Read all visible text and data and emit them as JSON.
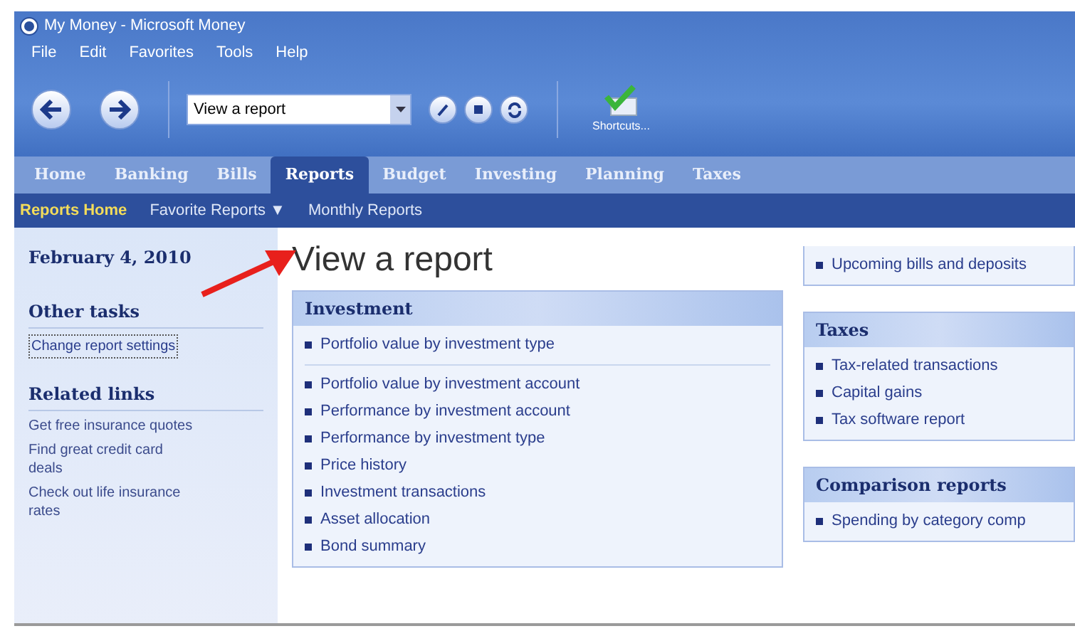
{
  "window": {
    "title": "My Money - Microsoft Money"
  },
  "menu": [
    "File",
    "Edit",
    "Favorites",
    "Tools",
    "Help"
  ],
  "toolbar": {
    "address": {
      "value": "View a report"
    },
    "shortcuts_label": "Shortcuts..."
  },
  "tabs": [
    {
      "label": "Home",
      "selected": false
    },
    {
      "label": "Banking",
      "selected": false
    },
    {
      "label": "Bills",
      "selected": false
    },
    {
      "label": "Reports",
      "selected": true
    },
    {
      "label": "Budget",
      "selected": false
    },
    {
      "label": "Investing",
      "selected": false
    },
    {
      "label": "Planning",
      "selected": false
    },
    {
      "label": "Taxes",
      "selected": false
    }
  ],
  "subnav": [
    {
      "label": "Reports Home",
      "selected": true
    },
    {
      "label": "Favorite Reports",
      "selected": false,
      "caret": "▼"
    },
    {
      "label": "Monthly Reports",
      "selected": false
    }
  ],
  "sidebar": {
    "date": "February 4, 2010",
    "other_tasks": {
      "heading": "Other tasks",
      "items": [
        "Change report settings"
      ]
    },
    "related_links": {
      "heading": "Related links",
      "items": [
        "Get free insurance quotes",
        "Find great credit card deals",
        "Check out life insurance rates"
      ]
    }
  },
  "page_title": "View a report",
  "left_column": [
    {
      "heading": "Investment",
      "groups": [
        [
          "Portfolio value by investment type"
        ],
        [
          "Portfolio value by investment account",
          "Performance by investment account",
          "Performance by investment type",
          "Price history",
          "Investment transactions",
          "Asset allocation",
          "Bond summary"
        ]
      ]
    }
  ],
  "right_column": [
    {
      "groups": [
        [
          "Upcoming bills and deposits"
        ]
      ]
    },
    {
      "heading": "Taxes",
      "groups": [
        [
          "Tax-related transactions",
          "Capital gains",
          "Tax software report"
        ]
      ]
    },
    {
      "heading": "Comparison reports",
      "groups": [
        [
          "Spending by category comp"
        ]
      ]
    }
  ]
}
